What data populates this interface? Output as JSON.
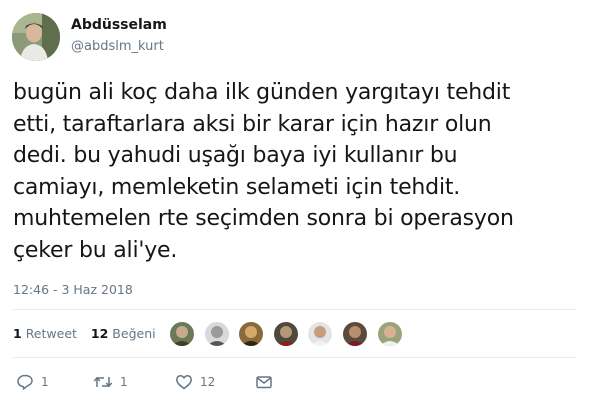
{
  "author": {
    "display_name": "Abdüsselam",
    "handle": "@abdslm_kurt"
  },
  "tweet": {
    "lines": [
      "bugün ali koç daha ilk günden yargıtayı tehdit",
      "etti, taraftarlara aksi bir karar için hazır olun",
      "dedi. bu yahudi uşağı baya iyi kullanır bu",
      "camiayı, memleketin selameti için tehdit.",
      "muhtemelen rte seçimden sonra bi operasyon",
      "çeker bu ali'ye."
    ],
    "timestamp": "12:46 - 3 Haz 2018"
  },
  "stats": {
    "retweets_count": "1",
    "retweets_label": "Retweet",
    "likes_count": "12",
    "likes_label": "Beğeni"
  },
  "actions": {
    "reply_count": "1",
    "retweet_count": "1",
    "like_count": "12"
  },
  "icons": {
    "reply": "reply-icon",
    "retweet": "retweet-icon",
    "like": "heart-icon",
    "dm": "envelope-icon"
  },
  "colors": {
    "text": "#14171a",
    "muted": "#657786",
    "divider": "#e6ecf0"
  }
}
